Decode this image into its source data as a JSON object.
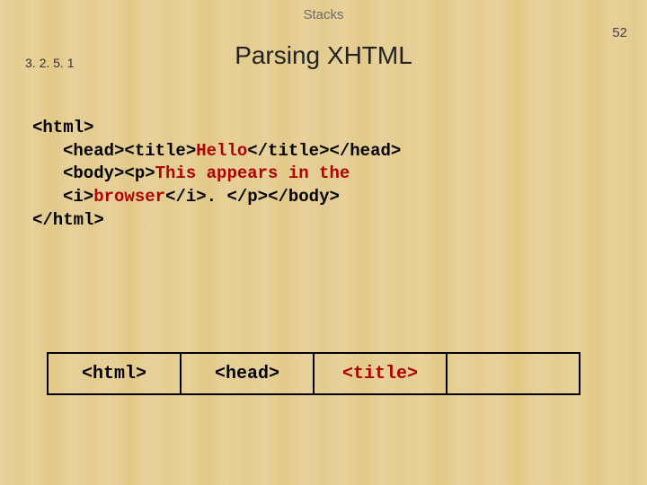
{
  "header": {
    "topic": "Stacks",
    "page_number": "52",
    "section_number": "3. 2. 5. 1",
    "title": "Parsing XHTML"
  },
  "code": {
    "l1": "<html>",
    "l2a": "<head><title>",
    "l2b": "Hello",
    "l2c": "</title></head>",
    "l3a": "<body><p>",
    "l3b": "This appears in the",
    "l4a": "<i>",
    "l4b": "browser",
    "l4c": "</i>. </p></body>",
    "l5": "</html>"
  },
  "stack": {
    "cell1": "<html>",
    "cell2": "<head>",
    "cell3": "<title>",
    "cell4": ""
  }
}
